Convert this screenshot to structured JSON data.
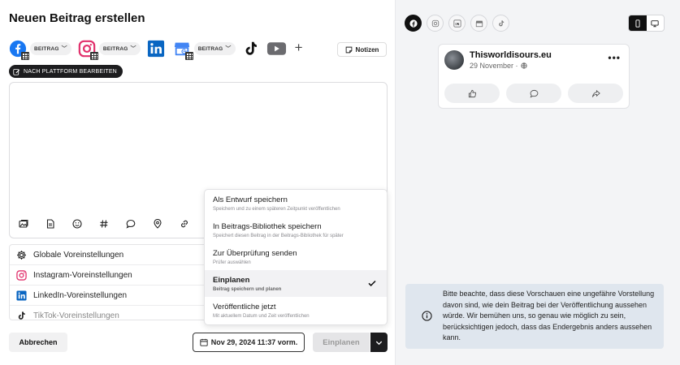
{
  "title": "Neuen Beitrag erstellen",
  "platforms": [
    {
      "name": "facebook-icon",
      "type_label": "BEITRAG"
    },
    {
      "name": "instagram-icon",
      "type_label": "BEITRAG"
    },
    {
      "name": "linkedin-icon"
    },
    {
      "name": "google-business-icon",
      "type_label": "BEITRAG"
    },
    {
      "name": "tiktok-icon"
    },
    {
      "name": "youtube-icon"
    }
  ],
  "notes_label": "Notizen",
  "edit_by_platform_label": "NACH PLATTFORM BEARBEITEN",
  "toolbar_icons": [
    "media-icon",
    "document-icon",
    "emoji-icon",
    "hashtag-icon",
    "comment-icon",
    "location-icon",
    "link-icon"
  ],
  "presets": [
    {
      "label": "Globale Voreinstellungen",
      "icon": "gear-icon"
    },
    {
      "label": "Instagram-Voreinstellungen",
      "icon": "instagram-icon"
    },
    {
      "label": "LinkedIn-Voreinstellungen",
      "icon": "linkedin-icon"
    },
    {
      "label": "TikTok-Voreinstellungen",
      "icon": "tiktok-icon"
    }
  ],
  "menu": {
    "items": [
      {
        "label": "Als Entwurf speichern",
        "sub": "Speichern und zu einem späteren Zeitpunkt veröffentlichen"
      },
      {
        "label": "In Beitrags-Bibliothek speichern",
        "sub": "Speichert diesen Beitrag in der Beitrags-Bibliothek für später"
      },
      {
        "label": "Zur Überprüfung senden",
        "sub": "Prüfer auswählen"
      },
      {
        "label": "Einplanen",
        "sub": "Beitrag speichern und planen"
      },
      {
        "label": "Veröffentliche jetzt",
        "sub": "Mit aktuellem Datum und Zeit veröffentlichen"
      }
    ],
    "selected_label": "Einplanen"
  },
  "footer": {
    "cancel_label": "Abbrechen",
    "date_label": "Nov 29, 2024 11:37 vorm.",
    "schedule_label": "Einplanen"
  },
  "preview": {
    "tabs": [
      "facebook-icon",
      "instagram-icon",
      "linkedin-icon",
      "google-business-icon",
      "tiktok-icon"
    ],
    "active_tab": "facebook-icon",
    "device_toggle": [
      "mobile-icon",
      "desktop-icon"
    ],
    "active_device": "mobile-icon",
    "post": {
      "page_name": "Thisworldisours.eu",
      "date": "29 November ·"
    },
    "notice": "Bitte beachte, dass diese Vorschauen eine ungefähre Vorstellung davon sind, wie dein Beitrag bei der Veröffentlichung aussehen würde. Wir bemühen uns, so genau wie möglich zu sein, berücksichtigen jedoch, dass das Endergebnis anders aussehen kann."
  },
  "colors": {
    "facebook": "#1877f2",
    "instagram": "#e1306c",
    "linkedin": "#0a66c2",
    "google_business": "#4285f4",
    "dark": "#1d1d1f",
    "notice_bg": "#dfe6ee"
  }
}
